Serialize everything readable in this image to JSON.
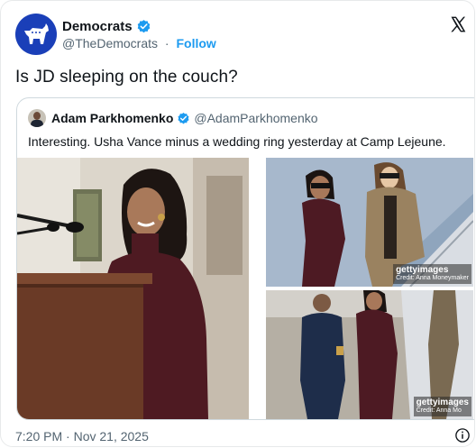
{
  "post": {
    "author_name": "Democrats",
    "author_handle": "@TheDemocrats",
    "separator": "·",
    "follow_label": "Follow",
    "text": "Is JD sleeping on the couch?",
    "timestamp": "7:20 PM · Nov 21, 2025"
  },
  "quote": {
    "author_name": "Adam Parkhomenko",
    "author_handle": "@AdamParkhomenko",
    "text": "Interesting. Usha Vance minus a wedding ring yesterday at Camp Lejeune.",
    "images": [
      {
        "name": "podium-photo"
      },
      {
        "name": "stairs-photo-top",
        "credit_brand": "gettyimages",
        "credit_text": "Credit: Anna Moneymaker"
      },
      {
        "name": "stairs-photo-bottom",
        "credit_brand": "gettyimages",
        "credit_text": "Credit: Anna Mo"
      }
    ]
  },
  "icons": {
    "avatar": "democratic-donkey-logo",
    "verified": "verified-badge-icon",
    "platform": "x-logo-icon",
    "info": "info-icon"
  },
  "colors": {
    "accent": "#1d9bf0",
    "brand_blue": "#1a3fb8",
    "text": "#0f1419",
    "muted": "#536471"
  }
}
